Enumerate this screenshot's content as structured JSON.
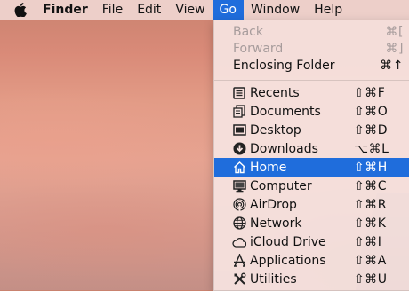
{
  "menubar": {
    "apple_icon": "apple-icon",
    "app_name": "Finder",
    "items": [
      "File",
      "Edit",
      "View",
      "Go",
      "Window",
      "Help"
    ],
    "active": "Go"
  },
  "go_menu": {
    "top_items": [
      {
        "label": "Back",
        "shortcut": "⌘[",
        "enabled": false
      },
      {
        "label": "Forward",
        "shortcut": "⌘]",
        "enabled": false
      },
      {
        "label": "Enclosing Folder",
        "shortcut": "⌘↑",
        "enabled": true
      }
    ],
    "items": [
      {
        "label": "Recents",
        "shortcut": "⇧⌘F",
        "icon": "recents-icon"
      },
      {
        "label": "Documents",
        "shortcut": "⇧⌘O",
        "icon": "documents-icon"
      },
      {
        "label": "Desktop",
        "shortcut": "⇧⌘D",
        "icon": "desktop-icon"
      },
      {
        "label": "Downloads",
        "shortcut": "⌥⌘L",
        "icon": "downloads-icon"
      },
      {
        "label": "Home",
        "shortcut": "⇧⌘H",
        "icon": "home-icon",
        "selected": true
      },
      {
        "label": "Computer",
        "shortcut": "⇧⌘C",
        "icon": "computer-icon"
      },
      {
        "label": "AirDrop",
        "shortcut": "⇧⌘R",
        "icon": "airdrop-icon"
      },
      {
        "label": "Network",
        "shortcut": "⇧⌘K",
        "icon": "network-icon"
      },
      {
        "label": "iCloud Drive",
        "shortcut": "⇧⌘I",
        "icon": "icloud-icon"
      },
      {
        "label": "Applications",
        "shortcut": "⇧⌘A",
        "icon": "applications-icon"
      },
      {
        "label": "Utilities",
        "shortcut": "⇧⌘U",
        "icon": "utilities-icon"
      }
    ]
  },
  "colors": {
    "selection": "#1f6ddc",
    "disabled_text": "#a79c9c"
  }
}
